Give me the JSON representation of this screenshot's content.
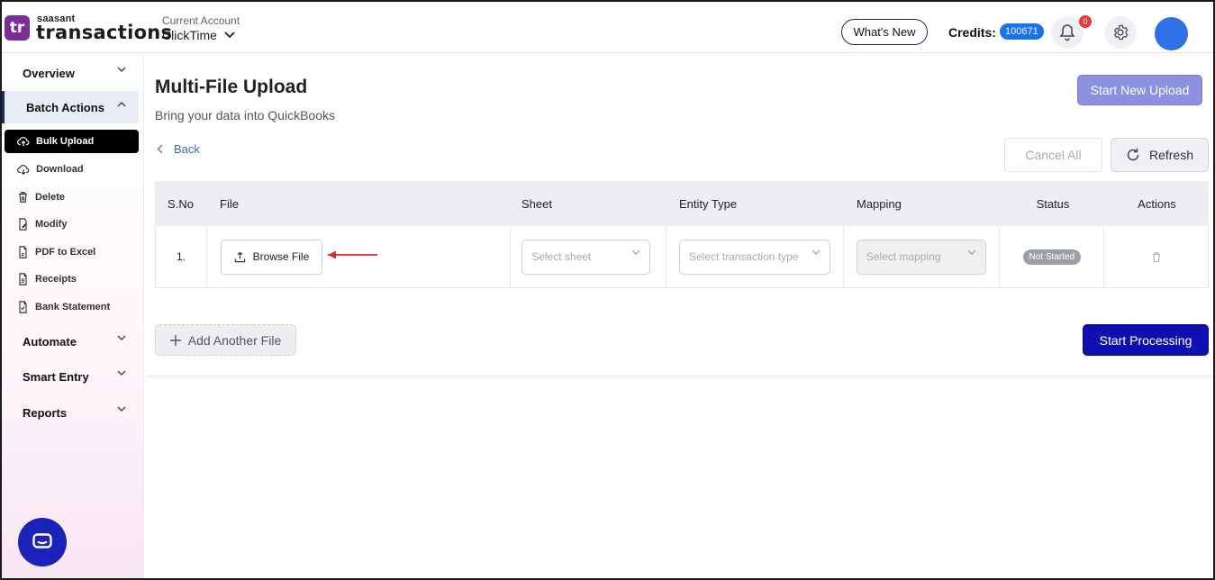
{
  "brand": {
    "logo_mark": "tr",
    "logo_small": "saasant",
    "logo_big": "transactions"
  },
  "header": {
    "account_label": "Current Account",
    "account_name": "ClickTime",
    "whats_new": "What's New",
    "credits_label": "Credits:",
    "credits_value": "100671",
    "notification_count": "0"
  },
  "sidebar": {
    "sections": {
      "overview": "Overview",
      "batch_actions": "Batch Actions",
      "automate": "Automate",
      "smart_entry": "Smart Entry",
      "reports": "Reports"
    },
    "batch_items": [
      {
        "label": "Bulk Upload",
        "icon": "upload-cloud-icon"
      },
      {
        "label": "Download",
        "icon": "download-cloud-icon"
      },
      {
        "label": "Delete",
        "icon": "trash-icon"
      },
      {
        "label": "Modify",
        "icon": "edit-file-icon"
      },
      {
        "label": "PDF to Excel",
        "icon": "pdf-icon"
      },
      {
        "label": "Receipts",
        "icon": "receipt-icon"
      },
      {
        "label": "Bank Statement",
        "icon": "statement-icon"
      }
    ]
  },
  "main": {
    "title": "Multi-File Upload",
    "subtitle": "Bring your data into QuickBooks",
    "start_new_upload": "Start New Upload",
    "back": "Back",
    "cancel_all": "Cancel All",
    "refresh": "Refresh",
    "add_another_file": "Add Another File",
    "start_processing": "Start Processing"
  },
  "table": {
    "headers": [
      "S.No",
      "File",
      "Sheet",
      "Entity Type",
      "Mapping",
      "Status",
      "Actions"
    ],
    "rows": [
      {
        "sno": "1.",
        "browse_label": "Browse File",
        "sheet_placeholder": "Select sheet",
        "entity_placeholder": "Select transaction type",
        "mapping_placeholder": "Select mapping",
        "status": "Not Started"
      }
    ]
  },
  "colors": {
    "brand_purple": "#7b2c96",
    "primary_blue": "#0f0fb0",
    "accent_lavender": "#8d8fe0",
    "credits_badge": "#1a73e8",
    "annotation_arrow": "#d32f2f"
  }
}
